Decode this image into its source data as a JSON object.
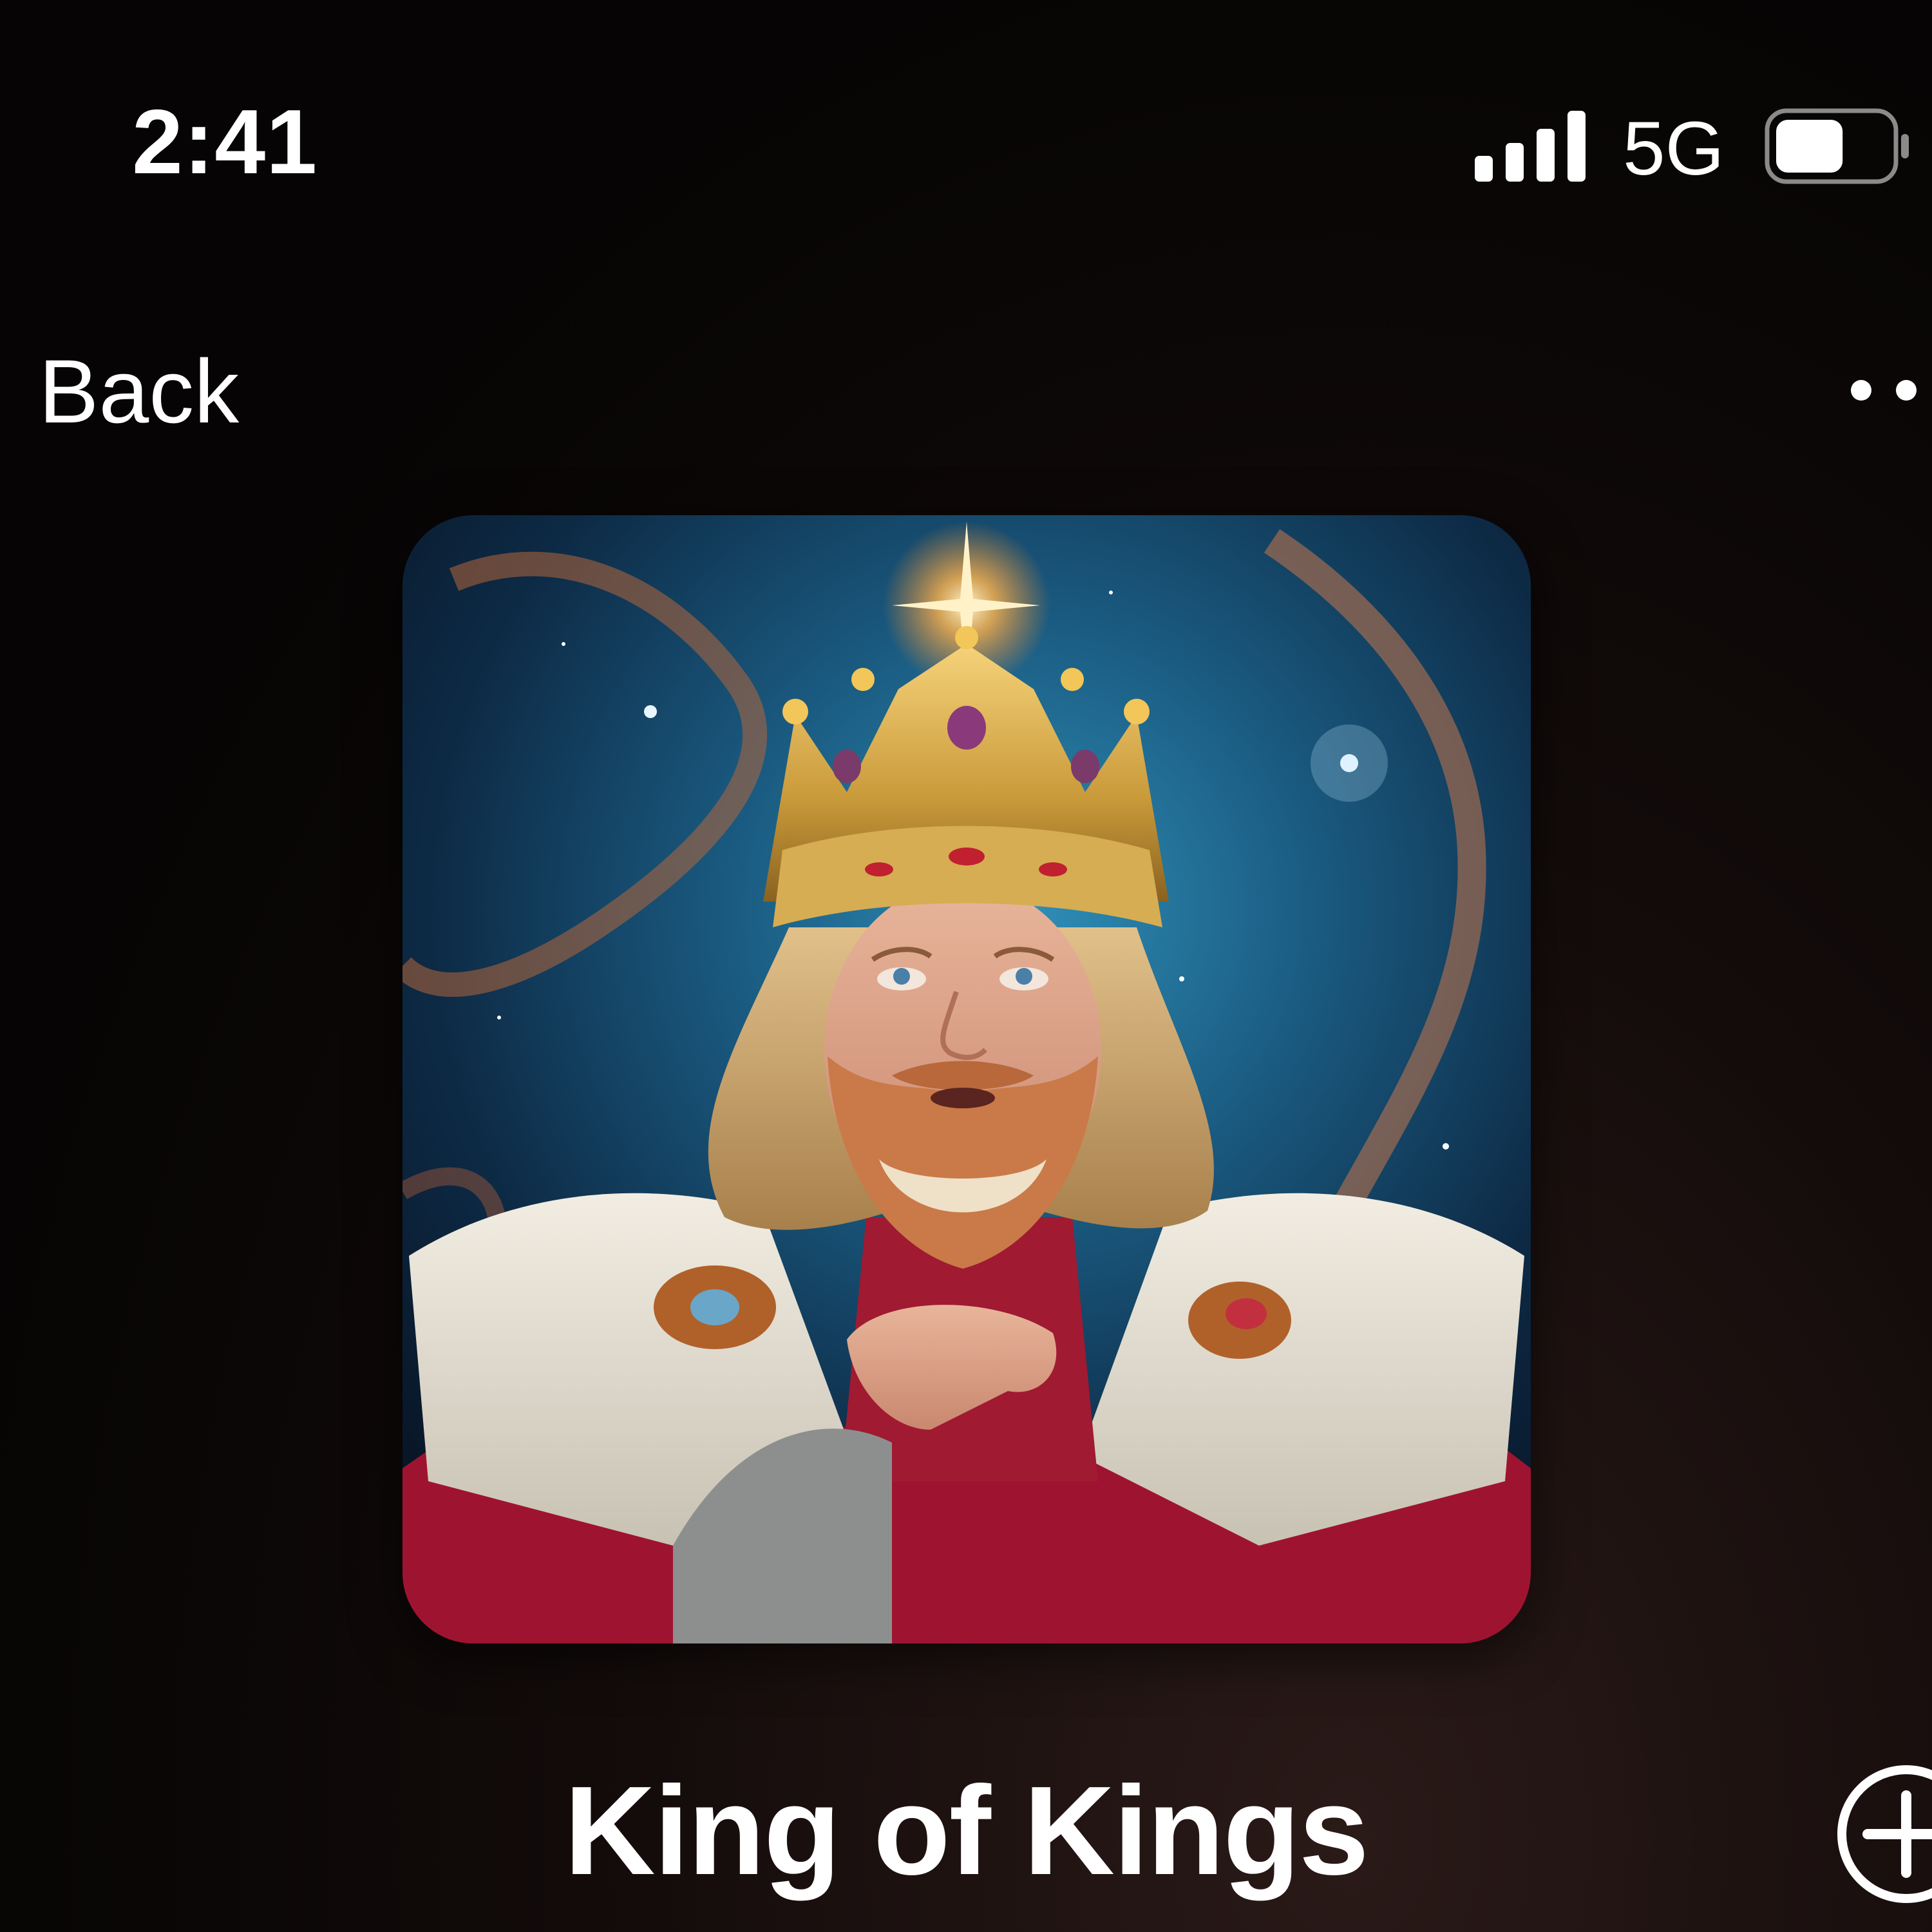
{
  "status_bar": {
    "time": "2:41",
    "network": "5G",
    "signal_icon": "cellular-signal-icon",
    "battery_icon": "battery-icon",
    "battery_level": 0.6
  },
  "nav": {
    "back_label": "Back",
    "more_icon": "more-dots-icon"
  },
  "track": {
    "title": "King of Kings",
    "artwork": "album-artwork",
    "add_icon": "add-circle-icon"
  },
  "colors": {
    "background": "#070505",
    "text": "#ffffff"
  }
}
